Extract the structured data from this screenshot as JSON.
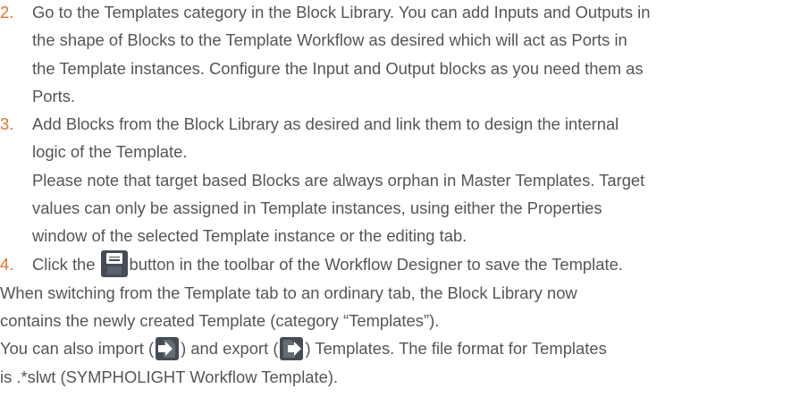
{
  "steps": [
    {
      "number": "2.",
      "lines": [
        "Go to the Templates category in the Block Library. You can add Inputs and Outputs in",
        "the shape of Blocks to the Template Workflow as desired which will act as Ports in",
        "the Template instances. Configure the Input and Output blocks as you need them as",
        "Ports."
      ]
    },
    {
      "number": "3.",
      "lines": [
        "Add Blocks from the Block Library as desired and link them to design the internal",
        "logic of the Template.",
        "Please note that target based Blocks are always orphan in Master Templates. Target",
        "values can only be assigned in Template instances, using either the Properties",
        "window of the selected Template instance or the editing tab."
      ]
    },
    {
      "number": "4.",
      "before_icon": "Click the",
      "after_icon": "button in the toolbar of the Workflow Designer to save the Template."
    }
  ],
  "paragraph_lines": [
    "When switching from the Template tab to an ordinary tab, the Block Library now",
    "contains the newly created Template (category “Templates”)."
  ],
  "import_export": {
    "part1": "You can also import (",
    "part2": ") and export (",
    "part3": ") Templates. The file format for Templates"
  },
  "last_line": "is .*slwt (SYMPHOLIGHT Workflow Template).",
  "icons": {
    "save": "save-icon",
    "import": "import-icon",
    "export": "export-icon"
  },
  "colors": {
    "text": "#555555",
    "step_number": "#e8702a",
    "icon_bg": "#454c55"
  }
}
